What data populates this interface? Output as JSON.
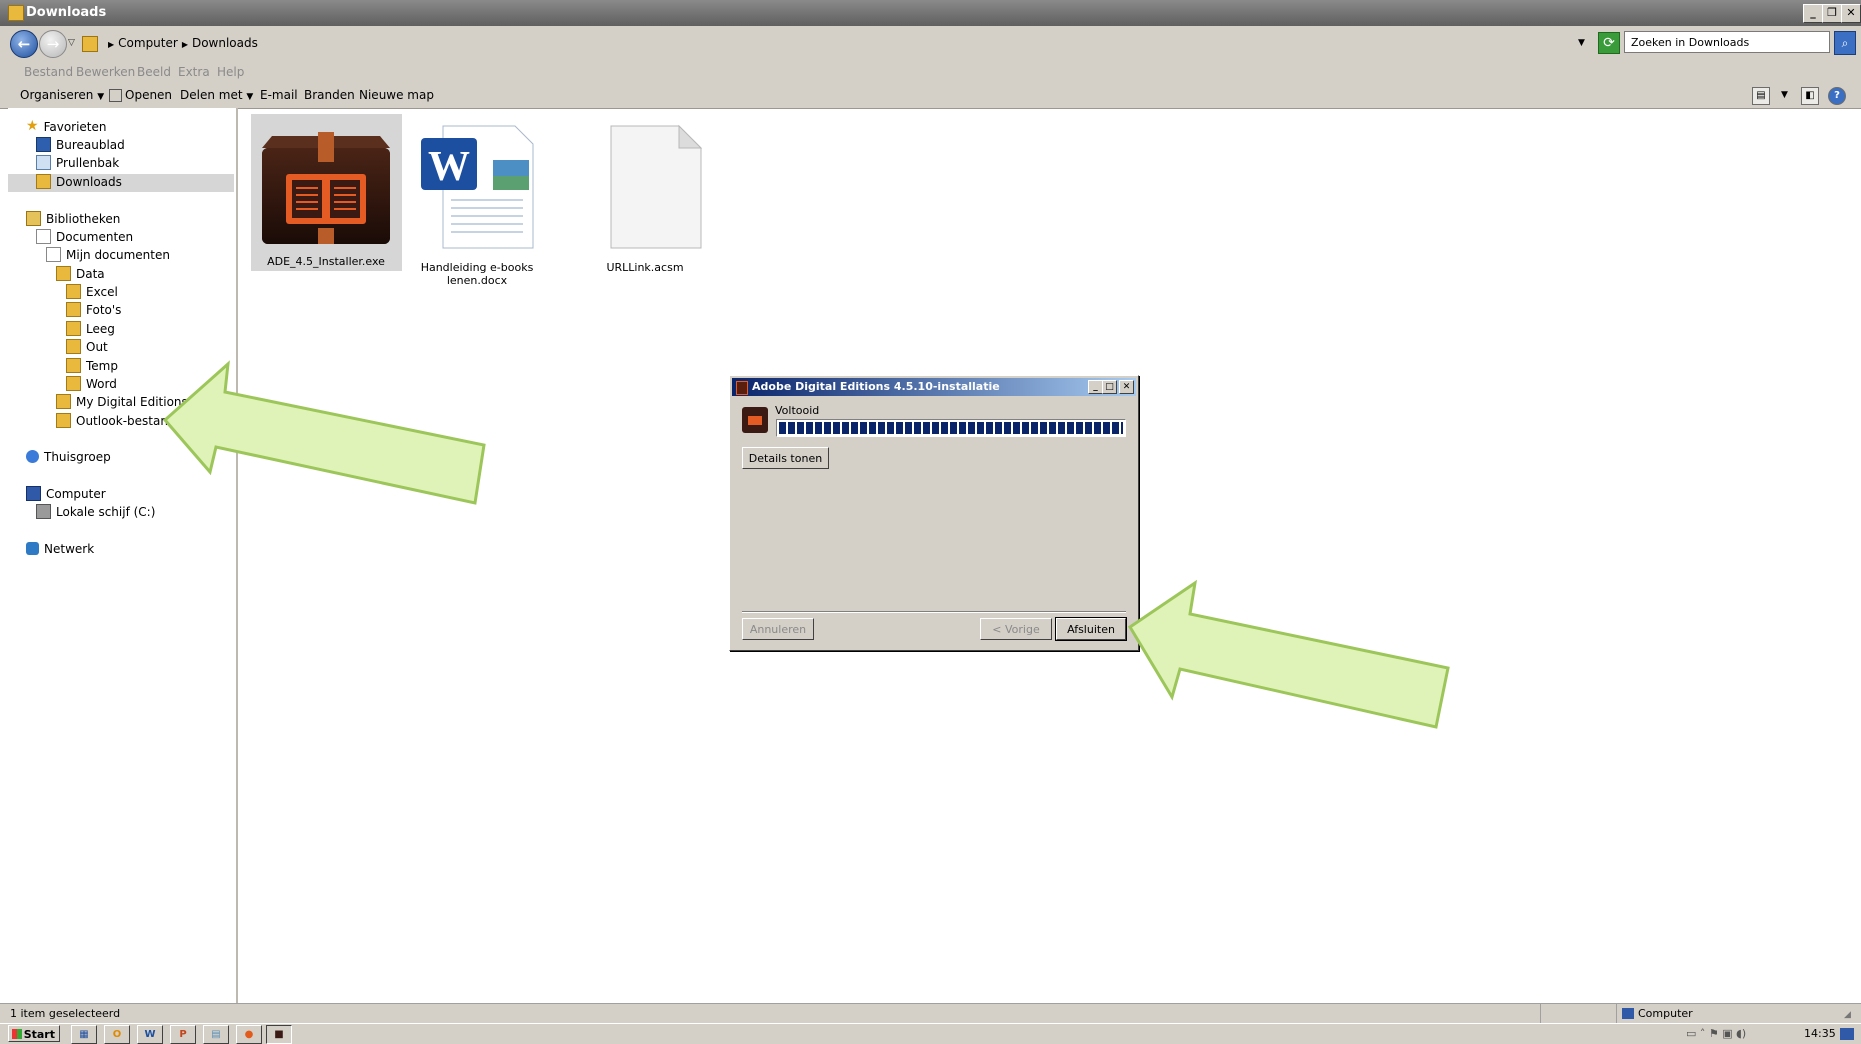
{
  "window": {
    "title": "Downloads"
  },
  "address": {
    "crumbs": [
      "Computer",
      "Downloads"
    ],
    "search_placeholder": "Zoeken in Downloads"
  },
  "menu": [
    "Bestand",
    "Bewerken",
    "Beeld",
    "Extra",
    "Help"
  ],
  "toolbar": {
    "organize": "Organiseren",
    "open": "Openen",
    "share": "Delen met",
    "email": "E-mail",
    "burn": "Branden",
    "new_folder": "Nieuwe map"
  },
  "sidebar": {
    "favorites": {
      "label": "Favorieten",
      "items": [
        "Bureaublad",
        "Prullenbak",
        "Downloads"
      ]
    },
    "libraries": {
      "label": "Bibliotheken"
    },
    "documents": "Documenten",
    "my_documents": "Mijn documenten",
    "data": "Data",
    "data_children": [
      "Excel",
      "Foto's",
      "Leeg",
      "Out",
      "Temp",
      "Word"
    ],
    "my_digital_editions": "My Digital Editions",
    "outlook": "Outlook-bestanden",
    "homegroup": "Thuisgroep",
    "computer": "Computer",
    "local_disk": "Lokale schijf (C:)",
    "network": "Netwerk"
  },
  "files": [
    {
      "name": "ADE_4.5_Installer.exe",
      "icon": "installer-box-icon",
      "selected": true
    },
    {
      "name_line1": "Handleiding e-books",
      "name_line2": "lenen.docx",
      "icon": "word-document-icon"
    },
    {
      "name": "URLLink.acsm",
      "icon": "blank-file-icon"
    }
  ],
  "status": {
    "selection": "1 item geselecteerd",
    "location": "Computer"
  },
  "taskbar": {
    "start": "Start",
    "clock": "14:35",
    "apps": [
      "explorer-icon",
      "outlook-icon",
      "word-icon",
      "powerpoint-icon",
      "notepad-icon",
      "firefox-icon",
      "ade-icon"
    ]
  },
  "dialog": {
    "title": "Adobe Digital Editions 4.5.10-installatie",
    "status": "Voltooid",
    "progress": 1.0,
    "details_button": "Details tonen",
    "cancel_button": "Annuleren",
    "back_button": "< Vorige",
    "finish_button": "Afsluiten"
  },
  "colors": {
    "arrow_fill": "#dff3b8",
    "arrow_stroke": "#9cc65a",
    "progress": "#0a246a",
    "dialog_title_start": "#0a246a"
  }
}
